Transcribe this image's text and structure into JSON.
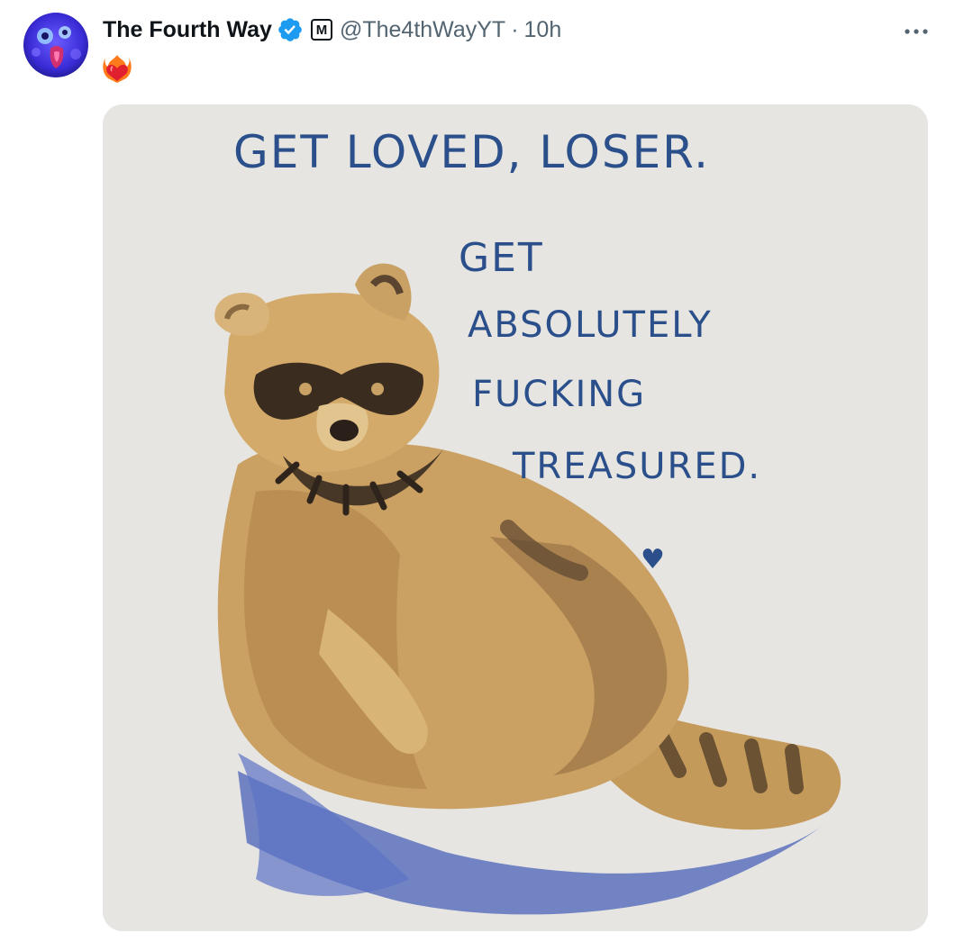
{
  "tweet": {
    "author": {
      "display_name": "The Fourth Way",
      "handle": "@The4thWayYT",
      "verified": true,
      "affiliate_badge": "M",
      "avatar_icon": "face-avatar-icon"
    },
    "separator": "·",
    "time": "10h",
    "more_icon": "more-dots-icon",
    "text_emoji": "❤️‍🔥",
    "media": {
      "title_line": "GET LOVED, LOSER.",
      "lines": [
        "GET",
        "ABSOLUTELY",
        "FUCKING",
        "TREASURED."
      ],
      "heart": "♥"
    },
    "colors": {
      "name": "#0f1419",
      "secondary": "#536471",
      "verified_blue": "#1d9bf0",
      "ink_blue": "#2a4f8a",
      "paper": "#e6e5e2"
    }
  }
}
